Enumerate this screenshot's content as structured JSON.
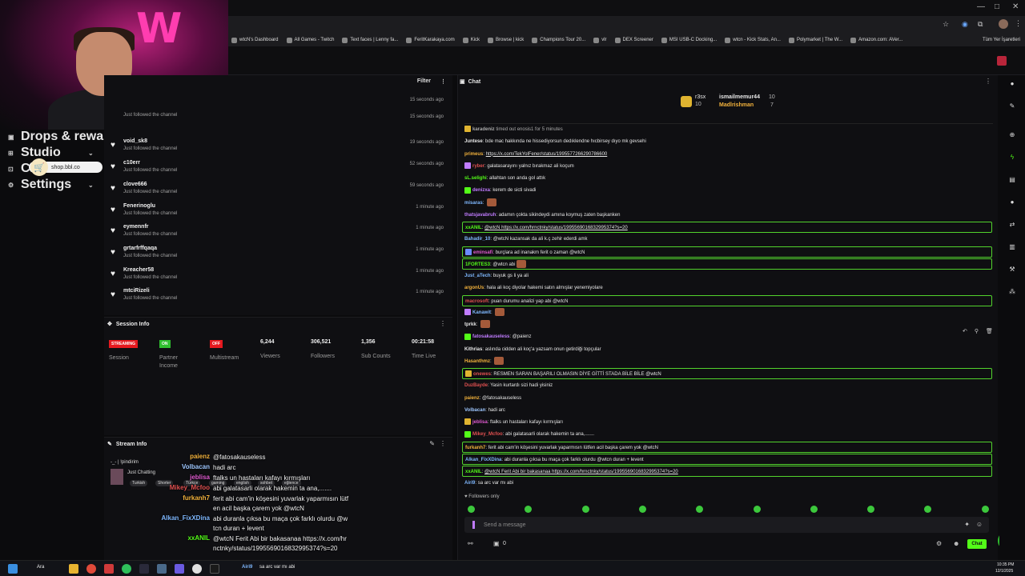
{
  "browser": {
    "bookmarks": [
      "wtcN's Dashboard",
      "All Games - Twitch",
      "Text faces | Lenny fa...",
      "FeritKarakaya.com",
      "Kick",
      "Browse | kick",
      "Champions Tour 20...",
      "vlr",
      "DEX Screener",
      "MSI USB-C Docking...",
      "wtcn - Kick Stats, An...",
      "Polymarket | The W...",
      "Amazon.com: AVer..."
    ],
    "bookmarks_other": "Tüm Yer İşaretleri"
  },
  "nav": {
    "drops": "Drops & rewards",
    "studio": "Studio",
    "channel": "Ch",
    "settings": "Settings",
    "shop": "shop.bbl.co"
  },
  "followers": {
    "filter": "Filter",
    "rows": [
      {
        "name": "",
        "action": "",
        "time": "15 seconds ago"
      },
      {
        "name": "",
        "action": "Just followed the channel",
        "time": "15 seconds ago"
      },
      {
        "name": "void_sk8",
        "action": "Just followed the channel",
        "time": "19 seconds ago"
      },
      {
        "name": "c10err",
        "action": "Just followed the channel",
        "time": "52 seconds ago"
      },
      {
        "name": "clove666",
        "action": "Just followed the channel",
        "time": "59 seconds ago"
      },
      {
        "name": "Fenerinoglu",
        "action": "Just followed the channel",
        "time": "1 minute ago"
      },
      {
        "name": "eymennfr",
        "action": "Just followed the channel",
        "time": "1 minute ago"
      },
      {
        "name": "grtarfrffqaqa",
        "action": "Just followed the channel",
        "time": "1 minute ago"
      },
      {
        "name": "Kreacher58",
        "action": "Just followed the channel",
        "time": "1 minute ago"
      },
      {
        "name": "mtciRizeli",
        "action": "Just followed the channel",
        "time": "1 minute ago"
      }
    ]
  },
  "session": {
    "title": "Session Info",
    "streaming": "STREAMING",
    "on": "ON",
    "off": "OFF",
    "session_label": "Session",
    "partner_label": "Partner",
    "income_label": "Income",
    "multistream_label": "Multistream",
    "viewers_value": "6,244",
    "viewers_label": "Viewers",
    "followers_value": "306,521",
    "followers_label": "Followers",
    "subs_value": "1,356",
    "subs_label": "Sub Counts",
    "time_value": "00:21:58",
    "time_label": "Time Live"
  },
  "stream": {
    "title": "Stream Info",
    "stream_title": "-_- | !pindirim",
    "category": "Just Chatting",
    "tags": [
      "Turkish",
      "Shorter",
      "Türkçe",
      "gaming",
      "english",
      "sohbet",
      "eğlence"
    ]
  },
  "overlay_chat": [
    {
      "user": "paienz",
      "text": "@fatosakauseless",
      "color": "#f2b23c"
    },
    {
      "user": "Volbacan",
      "text": "hadi arc",
      "color": "#9ec7ff"
    },
    {
      "user": "jeblisa",
      "text": "ftalks un hastaları kafayı kırmışları",
      "color": "#e05ad0"
    },
    {
      "user": "Mikey_Mcfoo",
      "text": "abi galatasarli olarak hakemin ta ana,.......",
      "color": "#e05050"
    },
    {
      "user": "furkanh7",
      "text": "ferit abi cam'in köşesini yuvarlak yaparmısın lütfen acil başka çarem yok @wtcN",
      "color": "#f2b23c"
    },
    {
      "user": "Alkan_FixXDina",
      "text": "abi duranla çıksa bu maça çok farklı olurdu @wtcn duran + levent",
      "color": "#7fb8ff"
    },
    {
      "user": "xxANIL",
      "text": "@wtcN Ferit Abi bir bakasanaa https://x.com/hrnctnky/status/1995569016832995374?s=20",
      "color": "#53fc18"
    }
  ],
  "chat": {
    "title": "Chat",
    "leaders": [
      {
        "name": "r3sx",
        "count": "10"
      },
      {
        "name": "ismailmemur44",
        "count": "10"
      },
      {
        "name": "Madlrishman",
        "count": "7"
      }
    ],
    "messages": [
      {
        "user": "karadeniz",
        "text": "timed out enosis1 for 5 minutes",
        "color": "#aaaaaa",
        "hl": false,
        "sys": true
      },
      {
        "user": "Juntese",
        "text": "bde mac hakkında ne hissediyorsun dedıklendne hıcbirsey dıyo mk gevsehi",
        "color": "#e6e6e6",
        "hl": false
      },
      {
        "user": "primeus",
        "text": "https://x.com/TekYolFener/status/1995577266290786600",
        "color": "#f2b23c",
        "hl": false,
        "link": true
      },
      {
        "user": "ryber",
        "text": "galatasarayını yalnız bırakmaz ali koçum",
        "color": "#e05050",
        "hl": false
      },
      {
        "user": "sL.selighi",
        "text": "allahtan son anda gol attık",
        "color": "#53fc18",
        "hl": false
      },
      {
        "user": "denizxa",
        "text": "kerem de sicti sivadi",
        "color": "#c07cff",
        "hl": false
      },
      {
        "user": "misaras",
        "text": "",
        "color": "#7fb8ff",
        "hl": false,
        "emote": true
      },
      {
        "user": "thatsjavabruh",
        "text": "adamın çokta sikindeydi amına koymuş zaten başkanken",
        "color": "#c07cff",
        "hl": false
      },
      {
        "user": "xxANIL",
        "text": "@wtcN https://x.com/hrnctnky/status/1995569016832995374?s=20",
        "color": "#53fc18",
        "hl": true,
        "link": true
      },
      {
        "user": "Bahadir_10",
        "text": "@wtcN kazansak da ali k.ç zehir ederdi amk",
        "color": "#7fb8ff",
        "hl": false
      },
      {
        "user": "eminsafi",
        "text": "burçlara ad inanakm ferit o zaman @wtcN",
        "color": "#e05ad0",
        "hl": true
      },
      {
        "user": "1FORTES3",
        "text": "@wtcn abi",
        "color": "#53fc18",
        "hl": true,
        "emote": true
      },
      {
        "user": "Just_aTech",
        "text": "buyuk gs li ya ali",
        "color": "#7fb8ff",
        "hl": false
      },
      {
        "user": "argonUs",
        "text": "hala ali koç diyolar hakemi satın almışlar yenemiyolare",
        "color": "#f2b23c",
        "hl": false
      },
      {
        "user": "macrosoft",
        "text": "puan durumu analizi yap abi @wtcN",
        "color": "#e05050",
        "hl": true
      },
      {
        "user": "Kanawit",
        "text": "",
        "color": "#7fb8ff",
        "hl": false,
        "emote": true
      },
      {
        "user": "tprkk",
        "text": "",
        "color": "#e6e6e6",
        "hl": false,
        "emote": true
      },
      {
        "user": "fatosakauseless",
        "text": "@paienz",
        "color": "#c07cff",
        "hl": false
      },
      {
        "user": "Kithrias",
        "text": "aslında cidden ali koç'a yazsam onun getirdiği topçular",
        "color": "#e6e6e6",
        "hl": false
      },
      {
        "user": "Hasanthmz",
        "text": "",
        "color": "#f2b23c",
        "hl": false,
        "emote": true
      },
      {
        "user": "onewes",
        "text": "RESMEN SARAN BAŞARILI OLMASIN DİYE GİTTİ STADA BİLE BİLE @wtcN",
        "color": "#e05050",
        "hl": true
      },
      {
        "user": "DuzBayde",
        "text": "Yasin kurtardı sizi hadi yisiniz",
        "color": "#e05050",
        "hl": false
      },
      {
        "user": "paienz",
        "text": "@fatosakauseless",
        "color": "#f2b23c",
        "hl": false
      },
      {
        "user": "Volbacan",
        "text": "hadi arc",
        "color": "#9ec7ff",
        "hl": false
      },
      {
        "user": "jeblisa",
        "text": "ftalks un hastaları kafayı kırmışları",
        "color": "#e05ad0",
        "hl": false
      },
      {
        "user": "Mikey_Mcfoo",
        "text": "abi galatasarli olarak hakemin ta ana,.......",
        "color": "#e05050",
        "hl": false
      },
      {
        "user": "furkanh7",
        "text": "ferit abi cam'in köşesini yuvarlak yaparmısın lütfen acil başka çarem yok @wtcN",
        "color": "#f2b23c",
        "hl": true
      },
      {
        "user": "Alkan_FixXDina",
        "text": "abi duranla çıksa bu maça çok farklı olurdu @wtcn duran + levent",
        "color": "#7fb8ff",
        "hl": true
      },
      {
        "user": "xxANIL",
        "text": "@wtcN Ferit Abi bir bakasanaa https://x.com/hrnctnky/status/1995569016832995374?s=20",
        "color": "#53fc18",
        "hl": true,
        "link": true
      },
      {
        "user": "Airi9",
        "text": "sa arc var mı abi",
        "color": "#7fb8ff",
        "hl": false
      }
    ],
    "followers_only": "Followers only",
    "placeholder": "Send a message",
    "send_label": "Chat",
    "count": "0"
  },
  "taskbar": {
    "search": "Ara",
    "ticker_user": "Airi9",
    "ticker_text": "sa arc var mı abi",
    "time": "10:35 PM",
    "date": "12/1/2025"
  },
  "colors": {
    "kick_green": "#53fc18",
    "streaming_red": "#e5191f",
    "on_green": "#2fbf2f"
  }
}
